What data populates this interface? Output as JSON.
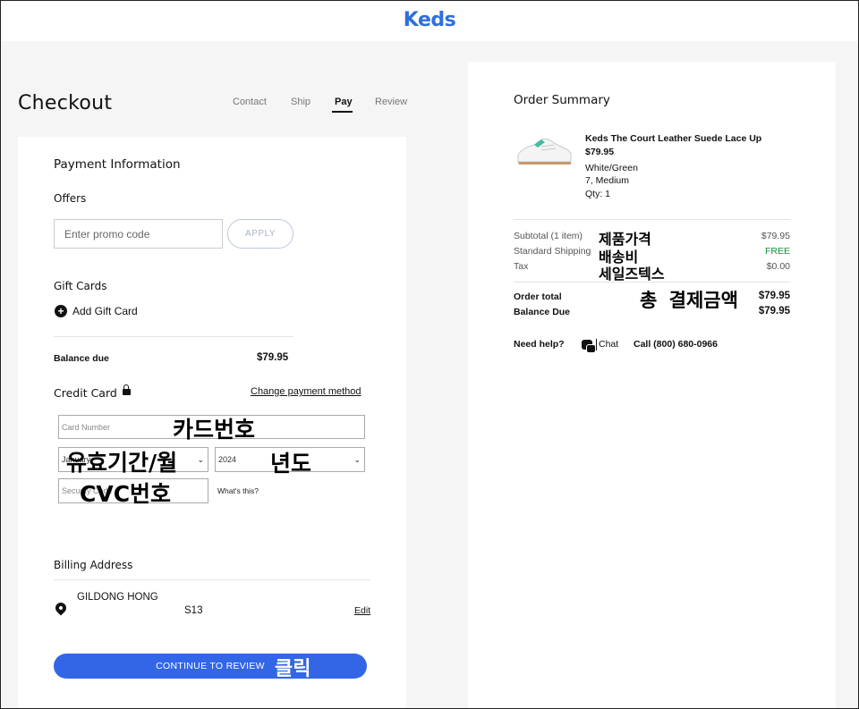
{
  "header": {
    "logo": "Keds"
  },
  "checkout": {
    "title": "Checkout",
    "steps": [
      "Contact",
      "Ship",
      "Pay",
      "Review"
    ],
    "active_step": "Pay"
  },
  "payment": {
    "title": "Payment Information",
    "offers_label": "Offers",
    "promo_placeholder": "Enter promo code",
    "apply_label": "APPLY",
    "gift_cards_label": "Gift Cards",
    "add_gift_card": "Add Gift Card",
    "balance_due_label": "Balance due",
    "balance_due_value": "$79.95",
    "credit_card_label": "Credit Card",
    "change_payment": "Change payment method",
    "card_number_placeholder": "Card Number",
    "month_value": "January",
    "year_value": "2024",
    "security_placeholder": "Security Code",
    "whats_this": "What's this?",
    "billing_title": "Billing Address",
    "billing_name": "GILDONG HONG",
    "billing_code": "S13",
    "edit_label": "Edit",
    "continue_label": "CONTINUE TO REVIEW"
  },
  "annotations": {
    "card_number": "카드번호",
    "expiry": "유효기간/월",
    "year": "년도",
    "cvc": "CVC번호",
    "click": "클릭",
    "subtotal": "제품가격",
    "shipping": "배송비",
    "tax": "세일즈텍스",
    "total": "총 결제금액"
  },
  "order_summary": {
    "title": "Order Summary",
    "product": {
      "name": "Keds The Court Leather Suede Lace Up",
      "price": "$79.95",
      "color": "White/Green",
      "size": "7, Medium",
      "qty": "Qty: 1"
    },
    "subtotal_label": "Subtotal (1 item)",
    "subtotal_value": "$79.95",
    "shipping_label": "Standard Shipping",
    "shipping_value": "FREE",
    "tax_label": "Tax",
    "tax_value": "$0.00",
    "order_total_label": "Order total",
    "order_total_value": "$79.95",
    "balance_due_label": "Balance Due",
    "balance_due_value": "$79.95",
    "help_label": "Need help?",
    "chat_label": "Chat",
    "call_label": "Call (800) 680-0966"
  },
  "colors": {
    "brand": "#2f6fdc",
    "button": "#3366e6",
    "free": "#1b8a3a"
  }
}
